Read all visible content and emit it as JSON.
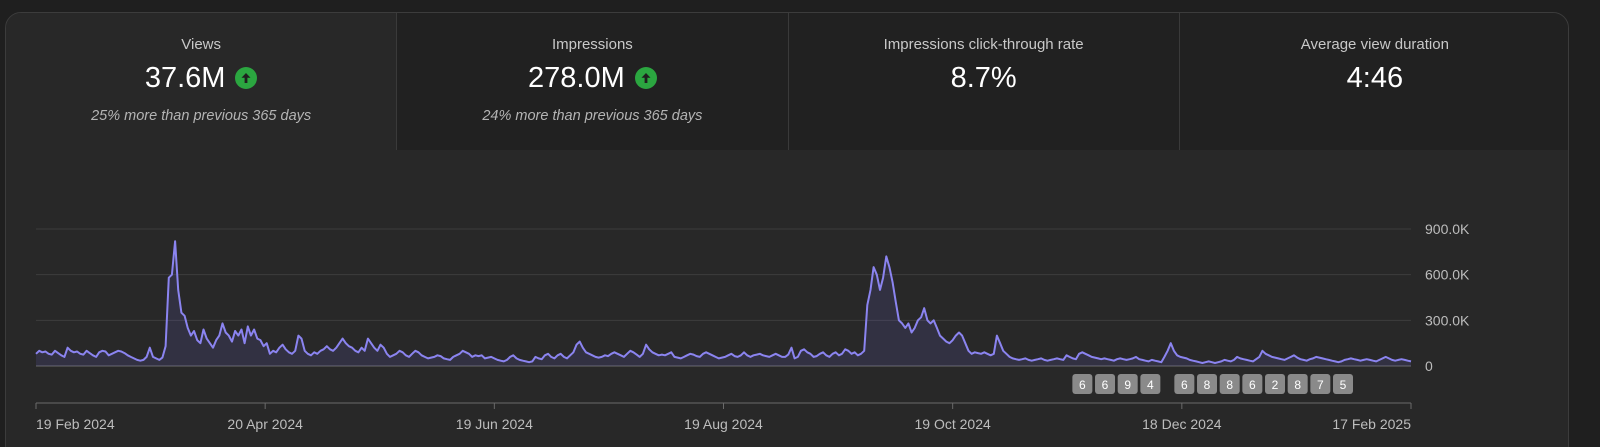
{
  "metrics": [
    {
      "label": "Views",
      "value": "37.6M",
      "trend": "up",
      "comparison": "25% more than previous 365 days",
      "selected": true
    },
    {
      "label": "Impressions",
      "value": "278.0M",
      "trend": "up",
      "comparison": "24% more than previous 365 days",
      "selected": false
    },
    {
      "label": "Impressions click-through rate",
      "value": "8.7%",
      "trend": null,
      "comparison": "",
      "selected": false
    },
    {
      "label": "Average view duration",
      "value": "4:46",
      "trend": null,
      "comparison": "",
      "selected": false
    }
  ],
  "colors": {
    "line": "#8b84f0",
    "area": "#6b63d0",
    "trend_up": "#2ba640",
    "grid": "#3d3d3d",
    "axis_text": "#bdbdbd",
    "marker_bg": "#8a8a8a"
  },
  "chart_data": {
    "type": "area",
    "series": [
      {
        "x_start": "2024-02-19",
        "x_end": "2025-02-17",
        "values": [
          80000,
          100000,
          90000,
          95000,
          80000,
          75000,
          100000,
          85000,
          70000,
          60000,
          120000,
          100000,
          90000,
          95000,
          80000,
          75000,
          100000,
          85000,
          70000,
          60000,
          90000,
          100000,
          95000,
          70000,
          80000,
          90000,
          100000,
          95000,
          85000,
          70000,
          60000,
          50000,
          40000,
          35000,
          40000,
          60000,
          120000,
          60000,
          50000,
          40000,
          55000,
          130000,
          580000,
          600000,
          820000,
          500000,
          350000,
          330000,
          250000,
          200000,
          230000,
          170000,
          150000,
          240000,
          180000,
          150000,
          120000,
          170000,
          200000,
          280000,
          220000,
          200000,
          160000,
          230000,
          200000,
          240000,
          150000,
          260000,
          200000,
          240000,
          180000,
          170000,
          130000,
          150000,
          80000,
          100000,
          90000,
          120000,
          140000,
          110000,
          90000,
          80000,
          100000,
          200000,
          180000,
          100000,
          80000,
          70000,
          90000,
          80000,
          100000,
          110000,
          130000,
          110000,
          100000,
          120000,
          150000,
          180000,
          150000,
          130000,
          120000,
          100000,
          90000,
          120000,
          100000,
          180000,
          150000,
          120000,
          100000,
          140000,
          120000,
          80000,
          60000,
          70000,
          80000,
          100000,
          90000,
          70000,
          60000,
          80000,
          100000,
          90000,
          70000,
          60000,
          50000,
          55000,
          60000,
          70000,
          65000,
          50000,
          45000,
          40000,
          60000,
          70000,
          80000,
          100000,
          90000,
          80000,
          60000,
          70000,
          65000,
          70000,
          50000,
          55000,
          60000,
          50000,
          40000,
          35000,
          30000,
          40000,
          60000,
          70000,
          50000,
          40000,
          35000,
          30000,
          25000,
          30000,
          60000,
          50000,
          45000,
          70000,
          80000,
          60000,
          50000,
          70000,
          80000,
          60000,
          50000,
          70000,
          90000,
          140000,
          160000,
          120000,
          90000,
          80000,
          70000,
          60000,
          55000,
          60000,
          70000,
          65000,
          80000,
          90000,
          80000,
          70000,
          60000,
          80000,
          100000,
          90000,
          75000,
          60000,
          80000,
          140000,
          110000,
          90000,
          80000,
          70000,
          75000,
          70000,
          80000,
          90000,
          60000,
          55000,
          50000,
          60000,
          70000,
          80000,
          75000,
          65000,
          60000,
          80000,
          90000,
          80000,
          70000,
          60000,
          50000,
          55000,
          60000,
          70000,
          80000,
          65000,
          60000,
          70000,
          90000,
          70000,
          60000,
          70000,
          75000,
          80000,
          70000,
          65000,
          60000,
          70000,
          80000,
          70000,
          60000,
          60000,
          75000,
          120000,
          50000,
          60000,
          100000,
          110000,
          90000,
          80000,
          60000,
          65000,
          80000,
          90000,
          70000,
          60000,
          80000,
          90000,
          70000,
          80000,
          110000,
          100000,
          80000,
          90000,
          70000,
          80000,
          100000,
          400000,
          500000,
          650000,
          600000,
          500000,
          580000,
          720000,
          650000,
          550000,
          420000,
          300000,
          280000,
          250000,
          280000,
          220000,
          250000,
          300000,
          320000,
          380000,
          300000,
          280000,
          300000,
          250000,
          200000,
          180000,
          160000,
          150000,
          170000,
          200000,
          220000,
          200000,
          150000,
          100000,
          80000,
          90000,
          85000,
          80000,
          90000,
          80000,
          70000,
          80000,
          200000,
          150000,
          100000,
          80000,
          60000,
          50000,
          45000,
          40000,
          45000,
          50000,
          40000,
          35000,
          40000,
          45000,
          50000,
          40000,
          35000,
          40000,
          45000,
          50000,
          45000,
          40000,
          70000,
          60000,
          50000,
          45000,
          80000,
          90000,
          80000,
          70000,
          60000,
          55000,
          50000,
          45000,
          50000,
          45000,
          40000,
          35000,
          45000,
          50000,
          45000,
          40000,
          45000,
          50000,
          60000,
          45000,
          40000,
          35000,
          30000,
          40000,
          35000,
          30000,
          25000,
          60000,
          100000,
          150000,
          100000,
          70000,
          60000,
          55000,
          50000,
          40000,
          35000,
          30000,
          25000,
          20000,
          25000,
          30000,
          25000,
          20000,
          25000,
          30000,
          40000,
          35000,
          30000,
          40000,
          60000,
          50000,
          45000,
          40000,
          35000,
          30000,
          45000,
          60000,
          100000,
          80000,
          70000,
          60000,
          55000,
          50000,
          45000,
          40000,
          50000,
          60000,
          70000,
          55000,
          45000,
          40000,
          35000,
          45000,
          50000,
          60000,
          55000,
          50000,
          45000,
          40000,
          35000,
          30000,
          25000,
          30000,
          40000,
          45000,
          50000,
          45000,
          40000,
          35000,
          40000,
          45000,
          40000,
          35000,
          30000,
          40000,
          50000,
          60000,
          50000,
          40000,
          35000,
          40000,
          45000,
          40000,
          35000,
          30000
        ]
      }
    ],
    "x_tick_labels": [
      "19 Feb 2024",
      "20 Apr 2024",
      "19 Jun 2024",
      "19 Aug 2024",
      "19 Oct 2024",
      "18 Dec 2024",
      "17 Feb 2025"
    ],
    "y_tick_labels": [
      "900.0K",
      "600.0K",
      "300.0K",
      "0"
    ],
    "y_ticks": [
      900000,
      600000,
      300000,
      0
    ],
    "ylim": [
      0,
      900000
    ],
    "grid": true,
    "markers": [
      {
        "label": "6",
        "date": "2024-11-22"
      },
      {
        "label": "6",
        "date": "2024-11-28"
      },
      {
        "label": "9",
        "date": "2024-12-04"
      },
      {
        "label": "4",
        "date": "2024-12-10"
      },
      {
        "label": "6",
        "date": "2024-12-19"
      },
      {
        "label": "8",
        "date": "2024-12-25"
      },
      {
        "label": "8",
        "date": "2024-12-31"
      },
      {
        "label": "6",
        "date": "2025-01-06"
      },
      {
        "label": "2",
        "date": "2025-01-12"
      },
      {
        "label": "8",
        "date": "2025-01-18"
      },
      {
        "label": "7",
        "date": "2025-01-24"
      },
      {
        "label": "5",
        "date": "2025-01-30"
      }
    ]
  }
}
